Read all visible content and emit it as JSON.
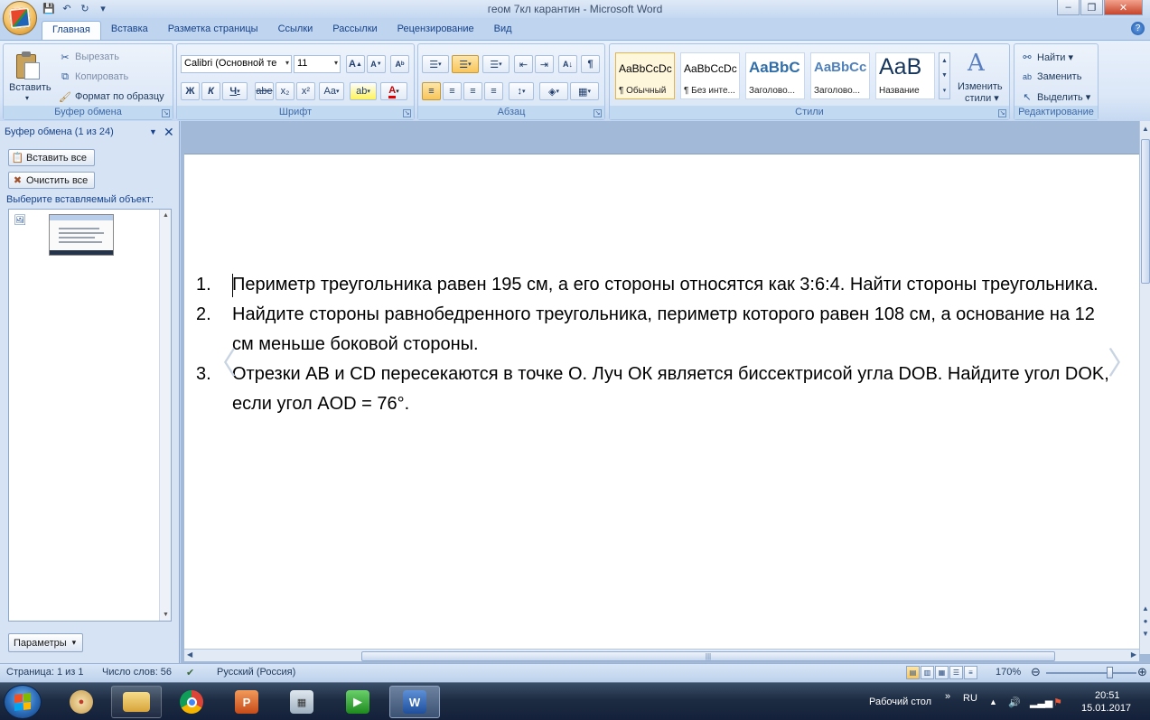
{
  "window": {
    "title": "геом 7кл карантин - Microsoft Word",
    "minimize": "–",
    "maximize": "❐",
    "close": "✕"
  },
  "qat": {
    "save_icon": "💾",
    "undo_icon": "↶",
    "redo_icon": "↻",
    "more_icon": "▾"
  },
  "tabs": [
    "Главная",
    "Вставка",
    "Разметка страницы",
    "Ссылки",
    "Рассылки",
    "Рецензирование",
    "Вид"
  ],
  "ribbon": {
    "clipboard": {
      "label": "Буфер обмена",
      "paste": "Вставить",
      "paste_arrow": "▾",
      "cut": "Вырезать",
      "copy": "Копировать",
      "format_painter": "Формат по образцу"
    },
    "font": {
      "label": "Шрифт",
      "font_name": "Calibri (Основной те",
      "font_size": "11",
      "grow": "A",
      "shrink": "A",
      "clear": "Aᵇ",
      "bold": "Ж",
      "italic": "К",
      "underline": "Ч",
      "strike": "abe",
      "subscript": "x₂",
      "superscript": "x²",
      "case": "Aa",
      "highlight": "ab",
      "font_color": "A"
    },
    "paragraph": {
      "label": "Абзац",
      "bullets": "☰",
      "numbering": "☰",
      "multilevel": "☰",
      "decrease_indent": "⇤",
      "increase_indent": "⇥",
      "sort": "A↓",
      "pilcrow": "¶",
      "align_left": "≡",
      "center": "≡",
      "align_right": "≡",
      "justify": "≡",
      "line_spacing": "↕",
      "shading": "◈",
      "borders": "▦"
    },
    "styles": {
      "label": "Стили",
      "items": [
        {
          "sample": "AaBbCcDc",
          "name": "¶ Обычный"
        },
        {
          "sample": "AaBbCcDc",
          "name": "¶ Без инте..."
        },
        {
          "sample": "AaBbC",
          "name": "Заголово..."
        },
        {
          "sample": "AaBbCc",
          "name": "Заголово..."
        },
        {
          "sample": "AaB",
          "name": "Название"
        }
      ],
      "change_styles_line1": "Изменить",
      "change_styles_line2": "стили ▾"
    },
    "editing": {
      "label": "Редактирование",
      "find": "Найти ▾",
      "replace": "Заменить",
      "select": "Выделить ▾"
    }
  },
  "clipboard_pane": {
    "title": "Буфер обмена (1 из 24)",
    "paste_all": "Вставить все",
    "clear_all": "Очистить все",
    "hint": "Выберите вставляемый объект:",
    "params": "Параметры",
    "params_arrow": "▾",
    "close": "✕",
    "menu": "▼"
  },
  "document": {
    "items": [
      {
        "num": "1.",
        "text": "Периметр треугольника равен 195 см, а его стороны относятся как 3:6:4. Найти стороны треугольника."
      },
      {
        "num": "2.",
        "text": "Найдите стороны равнобедренного треугольника, периметр которого равен 108 см, а основание на 12 см меньше боковой стороны."
      },
      {
        "num": "3.",
        "text": "Отрезки АВ и CD пересекаются в точке О. Луч ОК является биссектрисой угла DOB. Найдите угол DOK, если угол AOD = 76°."
      }
    ],
    "prev_arrow": "〈",
    "next_arrow": "〉"
  },
  "status": {
    "page": "Страница: 1 из 1",
    "words": "Число слов: 56",
    "language": "Русский (Россия)",
    "zoom": "170%",
    "zoom_minus": "⊖",
    "zoom_plus": "⊕",
    "zoom_level": 0.7
  },
  "taskbar": {
    "desktop": "Рабочий стол",
    "lang": "RU",
    "time": "20:51",
    "date": "15.01.2017",
    "chevrons": "»"
  },
  "colors": {
    "ribbon_bg": "#dbe7f7",
    "accent": "#15428b",
    "selected": "#f9c55a",
    "taskbar": "#1d2c42"
  }
}
